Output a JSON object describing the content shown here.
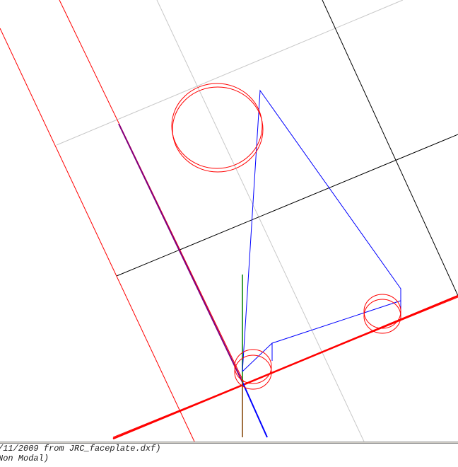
{
  "viewport": {
    "name": "cad-3d-viewport",
    "colors": {
      "grid_light": "#c8c8c8",
      "grid_dark": "#000000",
      "geometry_red": "#ff0000",
      "profile_blue": "#0000ff",
      "axis_x": "#ff0000",
      "axis_y": "#008000",
      "axis_z": "#0000ff",
      "toolpath_purple": "#800080"
    }
  },
  "console": {
    "lines": [
      "/11/2009 from JRC_faceplate.dxf)",
      "Non Modal)"
    ]
  }
}
